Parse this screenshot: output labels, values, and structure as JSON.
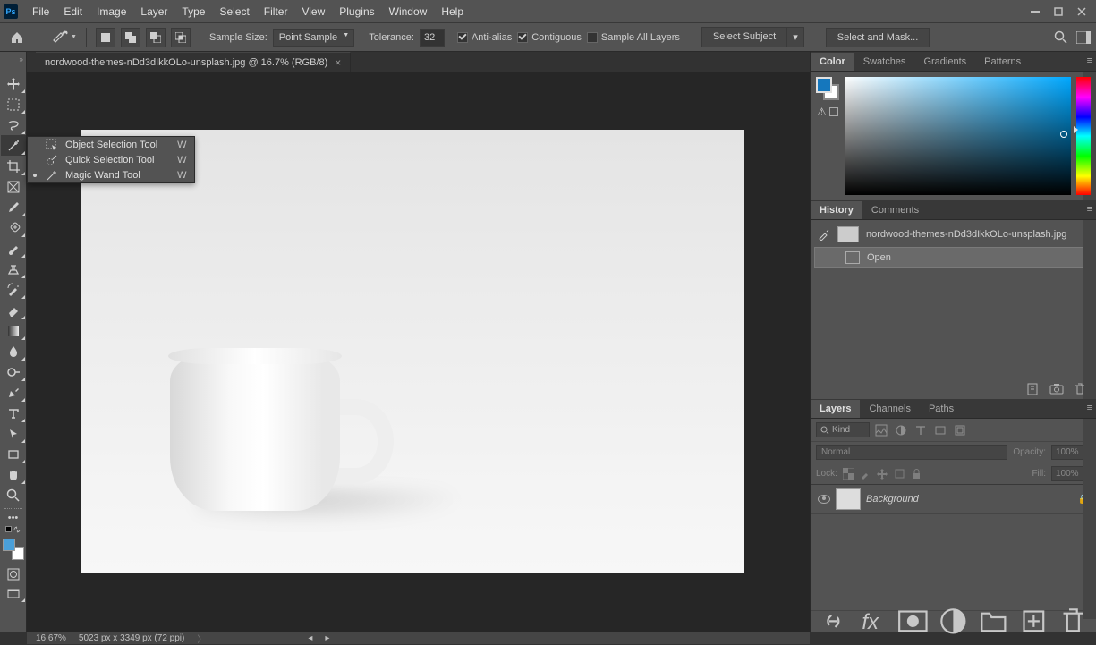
{
  "menu": {
    "items": [
      "File",
      "Edit",
      "Image",
      "Layer",
      "Type",
      "Select",
      "Filter",
      "View",
      "Plugins",
      "Window",
      "Help"
    ]
  },
  "options": {
    "sample_size_label": "Sample Size:",
    "sample_size_value": "Point Sample",
    "tolerance_label": "Tolerance:",
    "tolerance_value": "32",
    "anti_alias": {
      "label": "Anti-alias",
      "checked": true
    },
    "contiguous": {
      "label": "Contiguous",
      "checked": true
    },
    "sample_all": {
      "label": "Sample All Layers",
      "checked": false
    },
    "select_subject": "Select Subject",
    "select_mask": "Select and Mask..."
  },
  "document": {
    "tab_title": "nordwood-themes-nDd3dIkkOLo-unsplash.jpg @ 16.7% (RGB/8)",
    "zoom": "16.67%",
    "dimensions": "5023 px x 3349 px (72 ppi)"
  },
  "tool_flyout": {
    "items": [
      {
        "label": "Object Selection Tool",
        "shortcut": "W",
        "active": false
      },
      {
        "label": "Quick Selection Tool",
        "shortcut": "W",
        "active": false
      },
      {
        "label": "Magic Wand Tool",
        "shortcut": "W",
        "active": true
      }
    ]
  },
  "panels": {
    "color": {
      "tabs": [
        "Color",
        "Swatches",
        "Gradients",
        "Patterns"
      ],
      "active": 0
    },
    "history": {
      "tabs": [
        "History",
        "Comments"
      ],
      "active": 0,
      "source": "nordwood-themes-nDd3dIkkOLo-unsplash.jpg",
      "items": [
        "Open"
      ]
    },
    "layers": {
      "tabs": [
        "Layers",
        "Channels",
        "Paths"
      ],
      "active": 0,
      "filter_label": "Kind",
      "blend_mode": "Normal",
      "opacity_label": "Opacity:",
      "opacity_value": "100%",
      "lock_label": "Lock:",
      "fill_label": "Fill:",
      "fill_value": "100%",
      "layers": [
        {
          "name": "Background",
          "locked": true,
          "visible": true
        }
      ]
    }
  },
  "colors": {
    "foreground": "#1577bd",
    "background": "#ffffff"
  }
}
